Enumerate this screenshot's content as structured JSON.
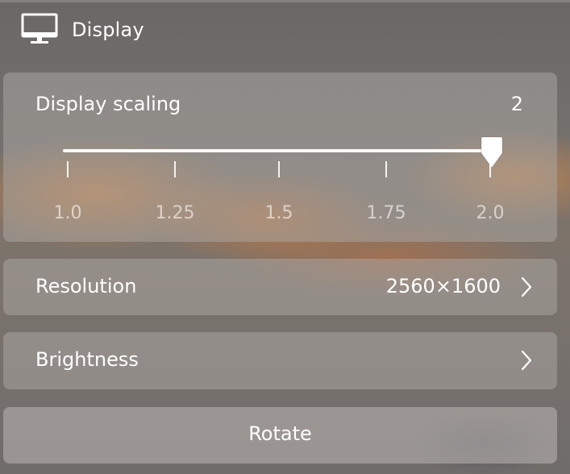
{
  "header": {
    "title": "Display",
    "icon": "monitor-icon"
  },
  "display_scaling": {
    "label": "Display scaling",
    "current_value": "2",
    "slider_value": 2.0,
    "ticks": [
      "1.0",
      "1.25",
      "1.5",
      "1.75",
      "2.0"
    ]
  },
  "resolution": {
    "label": "Resolution",
    "value": "2560×1600",
    "icon": "chevron-right-icon"
  },
  "brightness": {
    "label": "Brightness",
    "icon": "chevron-right-icon"
  },
  "rotate": {
    "label": "Rotate"
  },
  "colors": {
    "text": "#ffffff",
    "card": "#aaa6a3",
    "accent_warm": "#d6843e"
  }
}
